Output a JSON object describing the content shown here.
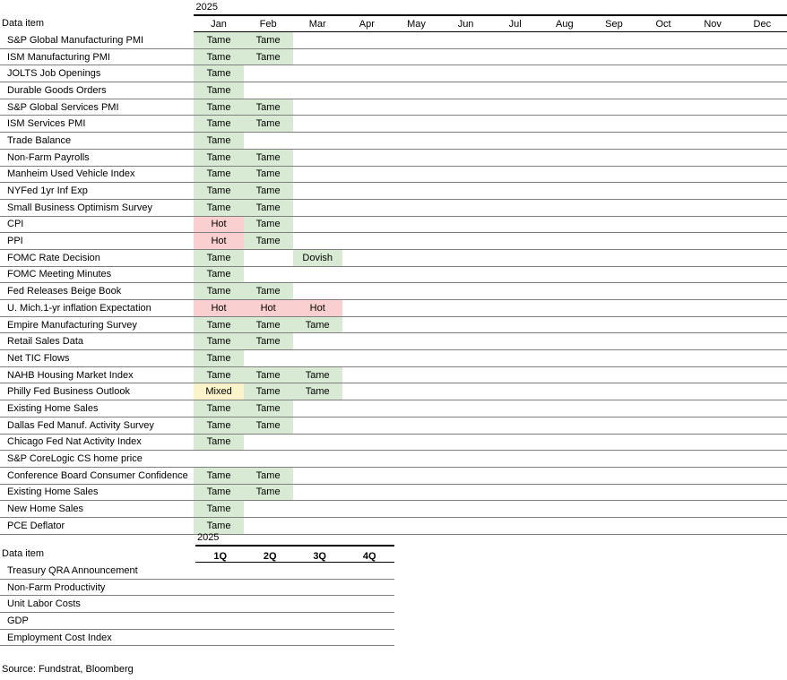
{
  "monthly_table": {
    "year_label": "2025",
    "row_header_label": "Data item",
    "columns": [
      "Jan",
      "Feb",
      "Mar",
      "Apr",
      "May",
      "Jun",
      "Jul",
      "Aug",
      "Sep",
      "Oct",
      "Nov",
      "Dec"
    ],
    "status_colors": {
      "Tame": "#d8ead3",
      "Hot": "#f9cfcf",
      "Mixed": "#fbf4cb",
      "Dovish": "#d8ead3"
    },
    "rows": [
      {
        "name": "S&P Global Manufacturing PMI",
        "values": [
          "Tame",
          "Tame",
          "",
          "",
          "",
          "",
          "",
          "",
          "",
          "",
          "",
          ""
        ]
      },
      {
        "name": "ISM Manufacturing PMI",
        "values": [
          "Tame",
          "Tame",
          "",
          "",
          "",
          "",
          "",
          "",
          "",
          "",
          "",
          ""
        ]
      },
      {
        "name": "JOLTS Job Openings",
        "values": [
          "Tame",
          "",
          "",
          "",
          "",
          "",
          "",
          "",
          "",
          "",
          "",
          ""
        ]
      },
      {
        "name": "Durable Goods Orders",
        "values": [
          "Tame",
          "",
          "",
          "",
          "",
          "",
          "",
          "",
          "",
          "",
          "",
          ""
        ]
      },
      {
        "name": "S&P Global Services PMI",
        "values": [
          "Tame",
          "Tame",
          "",
          "",
          "",
          "",
          "",
          "",
          "",
          "",
          "",
          ""
        ]
      },
      {
        "name": "ISM Services PMI",
        "values": [
          "Tame",
          "Tame",
          "",
          "",
          "",
          "",
          "",
          "",
          "",
          "",
          "",
          ""
        ]
      },
      {
        "name": "Trade Balance",
        "values": [
          "Tame",
          "",
          "",
          "",
          "",
          "",
          "",
          "",
          "",
          "",
          "",
          ""
        ]
      },
      {
        "name": "Non-Farm Payrolls",
        "values": [
          "Tame",
          "Tame",
          "",
          "",
          "",
          "",
          "",
          "",
          "",
          "",
          "",
          ""
        ]
      },
      {
        "name": "Manheim Used Vehicle Index",
        "values": [
          "Tame",
          "Tame",
          "",
          "",
          "",
          "",
          "",
          "",
          "",
          "",
          "",
          ""
        ]
      },
      {
        "name": "NYFed 1yr Inf Exp",
        "values": [
          "Tame",
          "Tame",
          "",
          "",
          "",
          "",
          "",
          "",
          "",
          "",
          "",
          ""
        ]
      },
      {
        "name": "Small Business Optimism Survey",
        "values": [
          "Tame",
          "Tame",
          "",
          "",
          "",
          "",
          "",
          "",
          "",
          "",
          "",
          ""
        ]
      },
      {
        "name": "CPI",
        "values": [
          "Hot",
          "Tame",
          "",
          "",
          "",
          "",
          "",
          "",
          "",
          "",
          "",
          ""
        ]
      },
      {
        "name": "PPI",
        "values": [
          "Hot",
          "Tame",
          "",
          "",
          "",
          "",
          "",
          "",
          "",
          "",
          "",
          ""
        ]
      },
      {
        "name": "FOMC Rate Decision",
        "values": [
          "Tame",
          "",
          "Dovish",
          "",
          "",
          "",
          "",
          "",
          "",
          "",
          "",
          ""
        ]
      },
      {
        "name": "FOMC Meeting Minutes",
        "values": [
          "Tame",
          "",
          "",
          "",
          "",
          "",
          "",
          "",
          "",
          "",
          "",
          ""
        ]
      },
      {
        "name": "Fed Releases Beige Book",
        "values": [
          "Tame",
          "Tame",
          "",
          "",
          "",
          "",
          "",
          "",
          "",
          "",
          "",
          ""
        ]
      },
      {
        "name": "U. Mich.1-yr  inflation Expectation",
        "values": [
          "Hot",
          "Hot",
          "Hot",
          "",
          "",
          "",
          "",
          "",
          "",
          "",
          "",
          ""
        ]
      },
      {
        "name": "Empire Manufacturing Survey",
        "values": [
          "Tame",
          "Tame",
          "Tame",
          "",
          "",
          "",
          "",
          "",
          "",
          "",
          "",
          ""
        ]
      },
      {
        "name": "Retail Sales Data",
        "values": [
          "Tame",
          "Tame",
          "",
          "",
          "",
          "",
          "",
          "",
          "",
          "",
          "",
          ""
        ]
      },
      {
        "name": "Net TIC Flows",
        "values": [
          "Tame",
          "",
          "",
          "",
          "",
          "",
          "",
          "",
          "",
          "",
          "",
          ""
        ]
      },
      {
        "name": "NAHB Housing Market Index",
        "values": [
          "Tame",
          "Tame",
          "Tame",
          "",
          "",
          "",
          "",
          "",
          "",
          "",
          "",
          ""
        ]
      },
      {
        "name": "Philly Fed Business Outlook",
        "values": [
          "Mixed",
          "Tame",
          "Tame",
          "",
          "",
          "",
          "",
          "",
          "",
          "",
          "",
          ""
        ]
      },
      {
        "name": "Existing Home Sales",
        "values": [
          "Tame",
          "Tame",
          "",
          "",
          "",
          "",
          "",
          "",
          "",
          "",
          "",
          ""
        ]
      },
      {
        "name": "Dallas Fed Manuf. Activity Survey",
        "values": [
          "Tame",
          "Tame",
          "",
          "",
          "",
          "",
          "",
          "",
          "",
          "",
          "",
          ""
        ]
      },
      {
        "name": "Chicago Fed Nat Activity Index",
        "values": [
          "Tame",
          "",
          "",
          "",
          "",
          "",
          "",
          "",
          "",
          "",
          "",
          ""
        ]
      },
      {
        "name": "S&P CoreLogic CS home price",
        "values": [
          "",
          "",
          "",
          "",
          "",
          "",
          "",
          "",
          "",
          "",
          "",
          ""
        ]
      },
      {
        "name": "Conference Board Consumer Confidence",
        "values": [
          "Tame",
          "Tame",
          "",
          "",
          "",
          "",
          "",
          "",
          "",
          "",
          "",
          ""
        ]
      },
      {
        "name": "Existing Home Sales",
        "values": [
          "Tame",
          "Tame",
          "",
          "",
          "",
          "",
          "",
          "",
          "",
          "",
          "",
          ""
        ]
      },
      {
        "name": "New Home Sales",
        "values": [
          "Tame",
          "",
          "",
          "",
          "",
          "",
          "",
          "",
          "",
          "",
          "",
          ""
        ]
      },
      {
        "name": "PCE Deflator",
        "values": [
          "Tame",
          "",
          "",
          "",
          "",
          "",
          "",
          "",
          "",
          "",
          "",
          ""
        ]
      }
    ]
  },
  "quarterly_table": {
    "year_label": "2025",
    "row_header_label": "Data item",
    "columns": [
      "1Q",
      "2Q",
      "3Q",
      "4Q"
    ],
    "rows": [
      {
        "name": "Treasury QRA Announcement",
        "values": [
          "",
          "",
          "",
          ""
        ]
      },
      {
        "name": "Non-Farm Productivity",
        "values": [
          "",
          "",
          "",
          ""
        ]
      },
      {
        "name": "Unit Labor Costs",
        "values": [
          "",
          "",
          "",
          ""
        ]
      },
      {
        "name": "GDP",
        "values": [
          "",
          "",
          "",
          ""
        ]
      },
      {
        "name": "Employment Cost Index",
        "values": [
          "",
          "",
          "",
          ""
        ]
      }
    ]
  },
  "source": "Source: Fundstrat, Bloomberg"
}
